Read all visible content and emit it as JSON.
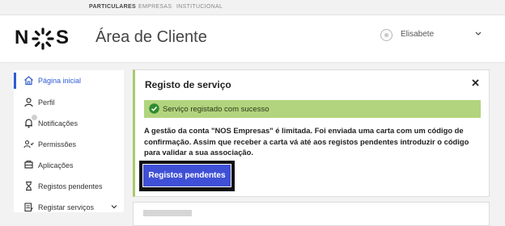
{
  "topnav": {
    "items": [
      "PARTICULARES",
      "EMPRESAS",
      "INSTITUCIONAL"
    ],
    "active": "PARTICULARES"
  },
  "header": {
    "logo_text": "NOS",
    "title": "Área de Cliente",
    "user_name": "Elisabete"
  },
  "sidebar": {
    "items": [
      {
        "label": "Página inicial",
        "icon": "home-icon",
        "active": true
      },
      {
        "label": "Perfil",
        "icon": "user-icon"
      },
      {
        "label": "Notificações",
        "icon": "bell-icon"
      },
      {
        "label": "Permissões",
        "icon": "permissions-icon"
      },
      {
        "label": "Aplicações",
        "icon": "apps-icon"
      },
      {
        "label": "Registos pendentes",
        "icon": "hourglass-icon"
      },
      {
        "label": "Registar serviços",
        "icon": "register-icon",
        "expandable": true
      }
    ]
  },
  "card": {
    "title": "Registo de serviço",
    "success_message": "Serviço registado com sucesso",
    "info_text": "A gestão da conta \"NOS Empresas\" é limitada. Foi enviada uma carta com um código de confirmação. Assim que receber a carta vá até aos registos pendentes introduzir o código para validar a sua associação.",
    "button_label": "Registos pendentes"
  },
  "colors": {
    "accent": "#2f5bd3",
    "success_bg": "#b2d47e",
    "success_icon": "#2e8b2e",
    "button_bg": "#3f50d6",
    "card_border_left": "#a8c96b"
  }
}
